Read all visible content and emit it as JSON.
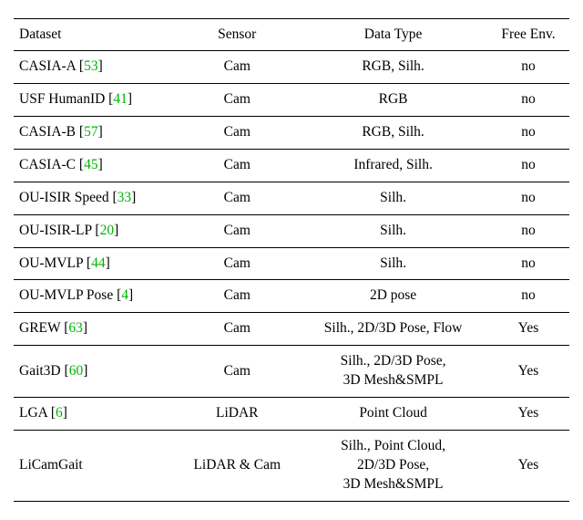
{
  "headers": [
    "Dataset",
    "Sensor",
    "Data Type",
    "Free Env."
  ],
  "rows": [
    {
      "name": "CASIA-A",
      "cite": "53",
      "sensor": "Cam",
      "datatype": "RGB, Silh.",
      "freeenv": "no"
    },
    {
      "name": "USF HumanID",
      "cite": "41",
      "sensor": "Cam",
      "datatype": "RGB",
      "freeenv": "no"
    },
    {
      "name": "CASIA-B",
      "cite": "57",
      "sensor": "Cam",
      "datatype": "RGB, Silh.",
      "freeenv": "no"
    },
    {
      "name": "CASIA-C",
      "cite": "45",
      "sensor": "Cam",
      "datatype": "Infrared, Silh.",
      "freeenv": "no"
    },
    {
      "name": "OU-ISIR Speed",
      "cite": "33",
      "sensor": "Cam",
      "datatype": "Silh.",
      "freeenv": "no"
    },
    {
      "name": "OU-ISIR-LP",
      "cite": "20",
      "sensor": "Cam",
      "datatype": "Silh.",
      "freeenv": "no"
    },
    {
      "name": "OU-MVLP",
      "cite": "44",
      "sensor": "Cam",
      "datatype": "Silh.",
      "freeenv": "no"
    },
    {
      "name": "OU-MVLP Pose",
      "cite": "4",
      "sensor": "Cam",
      "datatype": "2D pose",
      "freeenv": "no"
    },
    {
      "name": "GREW",
      "cite": "63",
      "sensor": "Cam",
      "datatype": "Silh., 2D/3D Pose, Flow",
      "freeenv": "Yes"
    },
    {
      "name": "Gait3D",
      "cite": "60",
      "sensor": "Cam",
      "datatype": "Silh., 2D/3D Pose,\n3D Mesh&SMPL",
      "freeenv": "Yes"
    },
    {
      "name": "LGA",
      "cite": "6",
      "sensor": "LiDAR",
      "datatype": "Point Cloud",
      "freeenv": "Yes"
    },
    {
      "name": "LiCamGait",
      "cite": "",
      "sensor": "LiDAR & Cam",
      "datatype": "Silh., Point Cloud,\n2D/3D Pose,\n3D Mesh&SMPL",
      "freeenv": "Yes"
    }
  ]
}
